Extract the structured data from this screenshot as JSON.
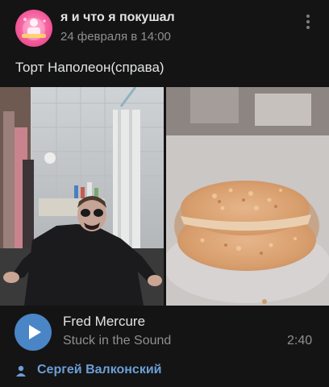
{
  "post": {
    "group_name": "я и что я покушал",
    "date": "24 февраля в 14:00",
    "text": "Торт Наполеон(справа)",
    "author": "Сергей Валконский"
  },
  "audio": {
    "artist": "Fred Mercure",
    "title": "Stuck in the Sound",
    "duration": "2:40"
  },
  "icons": {
    "menu": "more-vertical-icon",
    "play": "play-icon",
    "author": "person-icon"
  },
  "colors": {
    "background": "#141414",
    "text_primary": "#e1e3e6",
    "text_secondary": "#8e8f92",
    "accent": "#4a86c5",
    "link": "#6b9fd6"
  }
}
